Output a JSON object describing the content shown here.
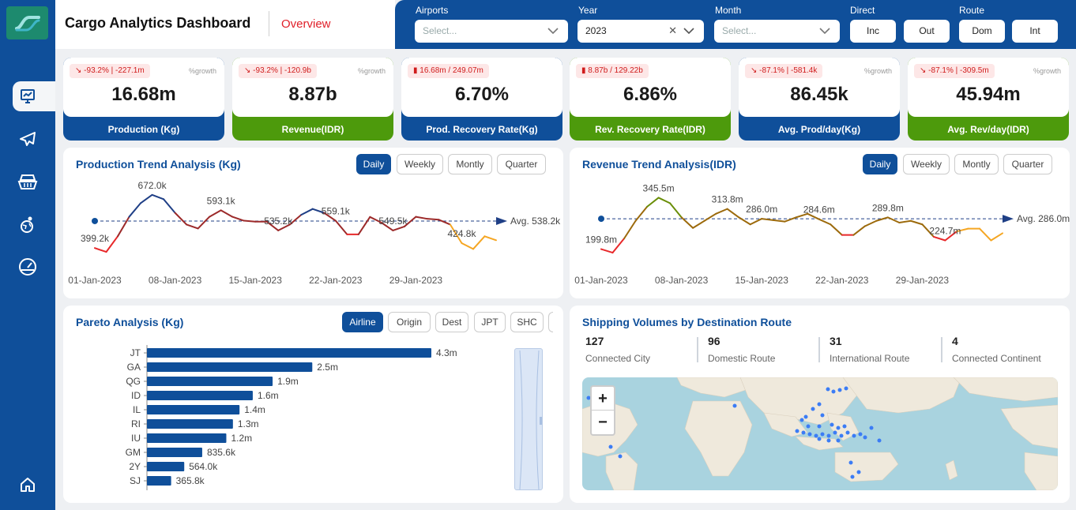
{
  "header": {
    "title": "Cargo Analytics Dashboard",
    "tab": "Overview"
  },
  "filters": {
    "airports": {
      "label": "Airports",
      "placeholder": "Select..."
    },
    "year": {
      "label": "Year",
      "value": "2023"
    },
    "month": {
      "label": "Month",
      "placeholder": "Select..."
    },
    "direct": {
      "label": "Direct",
      "options": [
        "Inc",
        "Out"
      ]
    },
    "route": {
      "label": "Route",
      "options": [
        "Dom",
        "Int"
      ]
    }
  },
  "kpis": [
    {
      "badge": "-93.2% | -227.1m",
      "growth": "%growth",
      "value": "16.68m",
      "label": "Production (Kg)",
      "color": "blue",
      "badge_type": "trend"
    },
    {
      "badge": "-93.2% | -120.9b",
      "growth": "%growth",
      "value": "8.87b",
      "label": "Revenue(IDR)",
      "color": "green",
      "badge_type": "trend"
    },
    {
      "badge": "16.68m / 249.07m",
      "growth": "",
      "value": "6.70%",
      "label": "Prod. Recovery Rate(Kg)",
      "color": "blue",
      "badge_type": "battery"
    },
    {
      "badge": "8.87b / 129.22b",
      "growth": "",
      "value": "6.86%",
      "label": "Rev. Recovery Rate(IDR)",
      "color": "green",
      "badge_type": "battery"
    },
    {
      "badge": "-87.1% | -581.4k",
      "growth": "%growth",
      "value": "86.45k",
      "label": "Avg. Prod/day(Kg)",
      "color": "blue",
      "badge_type": "trend"
    },
    {
      "badge": "-87.1% | -309.5m",
      "growth": "%growth",
      "value": "45.94m",
      "label": "Avg. Rev/day(IDR)",
      "color": "green",
      "badge_type": "trend"
    }
  ],
  "production_trend": {
    "title": "Production Trend Analysis (Kg)",
    "tabs": [
      "Daily",
      "Weekly",
      "Montly",
      "Quarter"
    ],
    "active_tab": "Daily"
  },
  "revenue_trend": {
    "title": "Revenue Trend Analysis(IDR)",
    "tabs": [
      "Daily",
      "Weekly",
      "Montly",
      "Quarter"
    ],
    "active_tab": "Daily"
  },
  "pareto": {
    "title": "Pareto Analysis (Kg)",
    "tabs": [
      "Airline",
      "Origin",
      "Dest",
      "JPT",
      "SHC"
    ],
    "active_tab": "Airline"
  },
  "shipping": {
    "title": "Shipping Volumes by Destination Route",
    "stats": [
      {
        "value": "127",
        "label": "Connected City"
      },
      {
        "value": "96",
        "label": "Domestic Route"
      },
      {
        "value": "31",
        "label": "International Route"
      },
      {
        "value": "4",
        "label": "Connected Continent"
      }
    ],
    "zoom_in": "+",
    "zoom_out": "−"
  },
  "chart_data": [
    {
      "type": "line",
      "title": "Production Trend Analysis (Kg)",
      "x": [
        "2023-01-01",
        "2023-01-02",
        "2023-01-03",
        "2023-01-04",
        "2023-01-05",
        "2023-01-06",
        "2023-01-07",
        "2023-01-08",
        "2023-01-09",
        "2023-01-10",
        "2023-01-11",
        "2023-01-12",
        "2023-01-13",
        "2023-01-14",
        "2023-01-15",
        "2023-01-16",
        "2023-01-17",
        "2023-01-18",
        "2023-01-19",
        "2023-01-20",
        "2023-01-21",
        "2023-01-22",
        "2023-01-23",
        "2023-01-24",
        "2023-01-25",
        "2023-01-26",
        "2023-01-27",
        "2023-01-28",
        "2023-01-29",
        "2023-01-30",
        "2023-01-31",
        "2023-02-01",
        "2023-02-02",
        "2023-02-03",
        "2023-02-04",
        "2023-02-05"
      ],
      "values": [
        400,
        380,
        460,
        560,
        630,
        672,
        650,
        580,
        520,
        500,
        560,
        593.1,
        560,
        540,
        535.2,
        535,
        490,
        520,
        570,
        600,
        580,
        540,
        470,
        470,
        559.1,
        530,
        490,
        510,
        560,
        549.5,
        545,
        520,
        424.8,
        395,
        460,
        440
      ],
      "xticks": [
        "01-Jan-2023",
        "08-Jan-2023",
        "15-Jan-2023",
        "22-Jan-2023",
        "29-Jan-2023"
      ],
      "point_labels": [
        {
          "x": "2023-01-01",
          "text": "399.2k"
        },
        {
          "x": "2023-01-06",
          "text": "672.0k"
        },
        {
          "x": "2023-01-12",
          "text": "593.1k"
        },
        {
          "x": "2023-01-17",
          "text": "535.2k"
        },
        {
          "x": "2023-01-22",
          "text": "559.1k"
        },
        {
          "x": "2023-01-27",
          "text": "549.5k"
        },
        {
          "x": "2023-02-02",
          "text": "424.8k"
        }
      ],
      "average": {
        "value": 538.2,
        "label": "Avg. 538.2k"
      },
      "ylim": [
        340,
        720
      ],
      "colors": {
        "high": "#1f3f86",
        "mid": "#9c2a2a",
        "low": "#e8282a",
        "tail": "#f5a623"
      }
    },
    {
      "type": "line",
      "title": "Revenue Trend Analysis(IDR)",
      "x": [
        "2023-01-01",
        "2023-01-02",
        "2023-01-03",
        "2023-01-04",
        "2023-01-05",
        "2023-01-06",
        "2023-01-07",
        "2023-01-08",
        "2023-01-09",
        "2023-01-10",
        "2023-01-11",
        "2023-01-12",
        "2023-01-13",
        "2023-01-14",
        "2023-01-15",
        "2023-01-16",
        "2023-01-17",
        "2023-01-18",
        "2023-01-19",
        "2023-01-20",
        "2023-01-21",
        "2023-01-22",
        "2023-01-23",
        "2023-01-24",
        "2023-01-25",
        "2023-01-26",
        "2023-01-27",
        "2023-01-28",
        "2023-01-29",
        "2023-01-30",
        "2023-01-31",
        "2023-02-01",
        "2023-02-02",
        "2023-02-03",
        "2023-02-04",
        "2023-02-05"
      ],
      "values": [
        200,
        190,
        230,
        280,
        320,
        345.5,
        330,
        290,
        260,
        280,
        300,
        313.8,
        290,
        270,
        286,
        282,
        278,
        290,
        300,
        284.6,
        270,
        240,
        240,
        265,
        280,
        289.8,
        275,
        280,
        270,
        235,
        224.7,
        250,
        258,
        258,
        224.7,
        245
      ],
      "xticks": [
        "01-Jan-2023",
        "08-Jan-2023",
        "15-Jan-2023",
        "22-Jan-2023",
        "29-Jan-2023"
      ],
      "point_labels": [
        {
          "x": "2023-01-01",
          "text": "199.8m"
        },
        {
          "x": "2023-01-06",
          "text": "345.5m"
        },
        {
          "x": "2023-01-12",
          "text": "313.8m"
        },
        {
          "x": "2023-01-15",
          "text": "286.0m"
        },
        {
          "x": "2023-01-20",
          "text": "284.6m"
        },
        {
          "x": "2023-01-26",
          "text": "289.8m"
        },
        {
          "x": "2023-01-31",
          "text": "224.7m"
        }
      ],
      "average": {
        "value": 286.0,
        "label": "Avg. 286.0m"
      },
      "ylim": [
        170,
        380
      ],
      "colors": {
        "high": "#6a8e08",
        "mid": "#9c6a0c",
        "low": "#e8282a",
        "tail": "#f5a623"
      }
    },
    {
      "type": "bar",
      "title": "Pareto Analysis (Kg)",
      "orientation": "horizontal",
      "categories": [
        "JT",
        "GA",
        "QG",
        "ID",
        "IL",
        "RI",
        "IU",
        "GM",
        "2Y",
        "SJ"
      ],
      "values": [
        4.3,
        2.5,
        1.9,
        1.6,
        1.4,
        1.3,
        1.2,
        0.8356,
        0.564,
        0.3658
      ],
      "value_labels": [
        "4.3m",
        "2.5m",
        "1.9m",
        "1.6m",
        "1.4m",
        "1.3m",
        "1.2m",
        "835.6k",
        "564.0k",
        "365.8k"
      ],
      "unit": "millions",
      "xlim": [
        0,
        4.3
      ],
      "color": "#0f4f9a"
    }
  ]
}
